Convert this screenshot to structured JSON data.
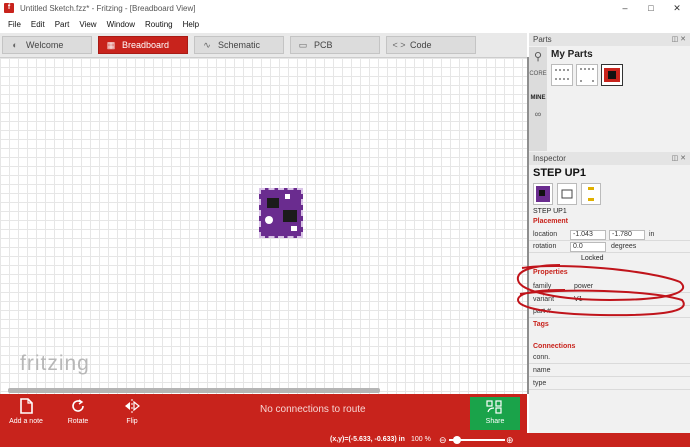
{
  "window": {
    "title": "Untitled Sketch.fzz* - Fritzing - [Breadboard View]",
    "minimize": "–",
    "maximize": "□",
    "close": "✕"
  },
  "menu": [
    "File",
    "Edit",
    "Part",
    "View",
    "Window",
    "Routing",
    "Help"
  ],
  "tabs": [
    {
      "label": "Welcome",
      "icon": "◐"
    },
    {
      "label": "Breadboard",
      "icon": "▦"
    },
    {
      "label": "Schematic",
      "icon": "∿"
    },
    {
      "label": "PCB",
      "icon": "▭"
    },
    {
      "label": "Code",
      "icon": "< >"
    }
  ],
  "canvas": {
    "watermark": "fritzing"
  },
  "toolbar": {
    "add_note": "Add a note",
    "rotate": "Rotate",
    "flip": "Flip",
    "share": "Share",
    "routing_status": "No connections to route"
  },
  "statusbar": {
    "coords": "(x,y)=(-5.633, -0.633) in",
    "zoom": "100 %"
  },
  "parts": {
    "title": "Parts",
    "bin_title": "My Parts",
    "side_core": "CORE",
    "side_mine": "MINE"
  },
  "inspector": {
    "title": "Inspector",
    "part_name": "STEP UP1",
    "part_caption": "STEP UP1",
    "placement_header": "Placement",
    "location_label": "location",
    "location_x": "-1.043",
    "location_y": "-1.780",
    "location_unit": "in",
    "rotation_label": "rotation",
    "rotation_value": "0.0",
    "rotation_unit": "degrees",
    "locked": "Locked",
    "properties_header": "Properties",
    "family_label": "family",
    "family_value": "power",
    "variant_label": "variant",
    "variant_value": "V1",
    "part_num_label": "part #",
    "tags_header": "Tags",
    "connections_header": "Connections",
    "conn_label": "conn.",
    "name_label": "name",
    "type_label": "type"
  },
  "colors": {
    "accent": "#c8231c",
    "share": "#1aa34a",
    "board": "#6a2c8f",
    "annotation": "#c0141b"
  }
}
